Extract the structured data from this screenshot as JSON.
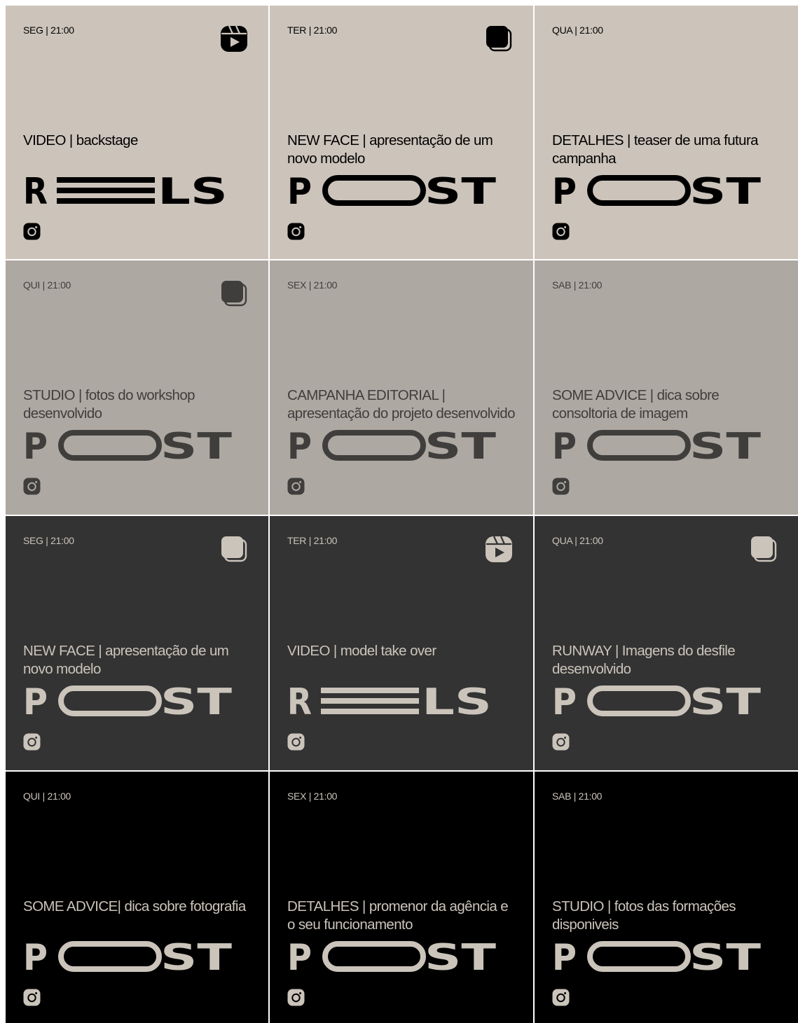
{
  "colors": {
    "row1_bg": "#ccc4bb",
    "row1_fg": "#000000",
    "row2_bg": "#aea8a2",
    "row2_fg": "#3f3e3c",
    "row3_bg": "#333333",
    "row3_fg": "#cbc4bb",
    "row4_bg": "#000000",
    "row4_fg": "#cbc4bb"
  },
  "tiles": [
    {
      "day": "SEG | 21:00",
      "type_icon": "reels-icon",
      "caption": "VIDEO | backstage",
      "word": "REELS"
    },
    {
      "day": "TER | 21:00",
      "type_icon": "carousel-icon",
      "caption": "NEW FACE | apresentação de um novo modelo",
      "word": "POST"
    },
    {
      "day": "QUA | 21:00",
      "type_icon": "",
      "caption": "DETALHES | teaser de uma futura campanha",
      "word": "POST"
    },
    {
      "day": "QUI | 21:00",
      "type_icon": "carousel-icon",
      "caption": "STUDIO | fotos do workshop desenvolvido",
      "word": "POST"
    },
    {
      "day": "SEX | 21:00",
      "type_icon": "",
      "caption": "CAMPANHA EDITORIAL | apresentação do projeto desenvolvido",
      "word": "POST"
    },
    {
      "day": "SAB | 21:00",
      "type_icon": "",
      "caption": "SOME ADVICE | dica sobre consoltoria de imagem",
      "word": "POST"
    },
    {
      "day": "SEG | 21:00",
      "type_icon": "carousel-icon",
      "caption": "NEW FACE | apresentação de um novo modelo",
      "word": "POST"
    },
    {
      "day": "TER | 21:00",
      "type_icon": "reels-icon",
      "caption": "VIDEO | model take over",
      "word": "REELS"
    },
    {
      "day": "QUA | 21:00",
      "type_icon": "carousel-icon",
      "caption": "RUNWAY | Imagens do desfile desenvolvido",
      "word": "POST"
    },
    {
      "day": "QUI | 21:00",
      "type_icon": "",
      "caption": "SOME ADVICE| dica sobre fotografia",
      "word": "POST"
    },
    {
      "day": "SEX | 21:00",
      "type_icon": "",
      "caption": "DETALHES | promenor da agência e o seu funcionamento",
      "word": "POST"
    },
    {
      "day": "SAB | 21:00",
      "type_icon": "",
      "caption": "STUDIO | fotos das formações disponiveis",
      "word": "POST"
    }
  ],
  "footer_icon": "instagram-icon"
}
